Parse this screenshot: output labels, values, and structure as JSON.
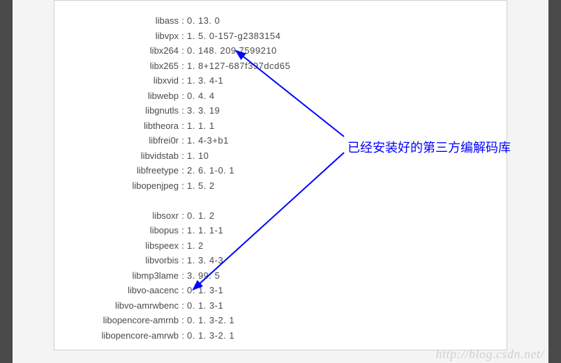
{
  "annotation": "已经安装好的第三方编解码库",
  "watermark": "http://blog.csdn.net/",
  "libs_top": [
    {
      "name": "libass",
      "value": "0. 13. 0"
    },
    {
      "name": "libvpx",
      "value": "1. 5. 0-157-g2383154"
    },
    {
      "name": "libx264",
      "value": "0. 148. 209 7599210"
    },
    {
      "name": "libx265",
      "value": "1. 8+127-687f397dcd65"
    },
    {
      "name": "libxvid",
      "value": "1. 3. 4-1"
    },
    {
      "name": "libwebp",
      "value": "0. 4. 4"
    },
    {
      "name": "libgnutls",
      "value": "3. 3. 19"
    },
    {
      "name": "libtheora",
      "value": "1. 1. 1"
    },
    {
      "name": "libfrei0r",
      "value": "1. 4-3+b1"
    },
    {
      "name": "libvidstab",
      "value": "1. 10"
    },
    {
      "name": "libfreetype",
      "value": "2. 6. 1-0. 1"
    },
    {
      "name": "libopenjpeg",
      "value": "1. 5. 2"
    }
  ],
  "libs_bottom": [
    {
      "name": "libsoxr",
      "value": "0. 1. 2"
    },
    {
      "name": "libopus",
      "value": "1. 1. 1-1"
    },
    {
      "name": "libspeex",
      "value": "1. 2"
    },
    {
      "name": "libvorbis",
      "value": "1. 3. 4-3"
    },
    {
      "name": "libmp3lame",
      "value": "3. 99. 5"
    },
    {
      "name": "libvo-aacenc",
      "value": "0. 1. 3-1"
    },
    {
      "name": "libvo-amrwbenc",
      "value": "0. 1. 3-1"
    },
    {
      "name": "libopencore-amrnb",
      "value": "0. 1. 3-2. 1"
    },
    {
      "name": "libopencore-amrwb",
      "value": "0. 1. 3-2. 1"
    }
  ]
}
